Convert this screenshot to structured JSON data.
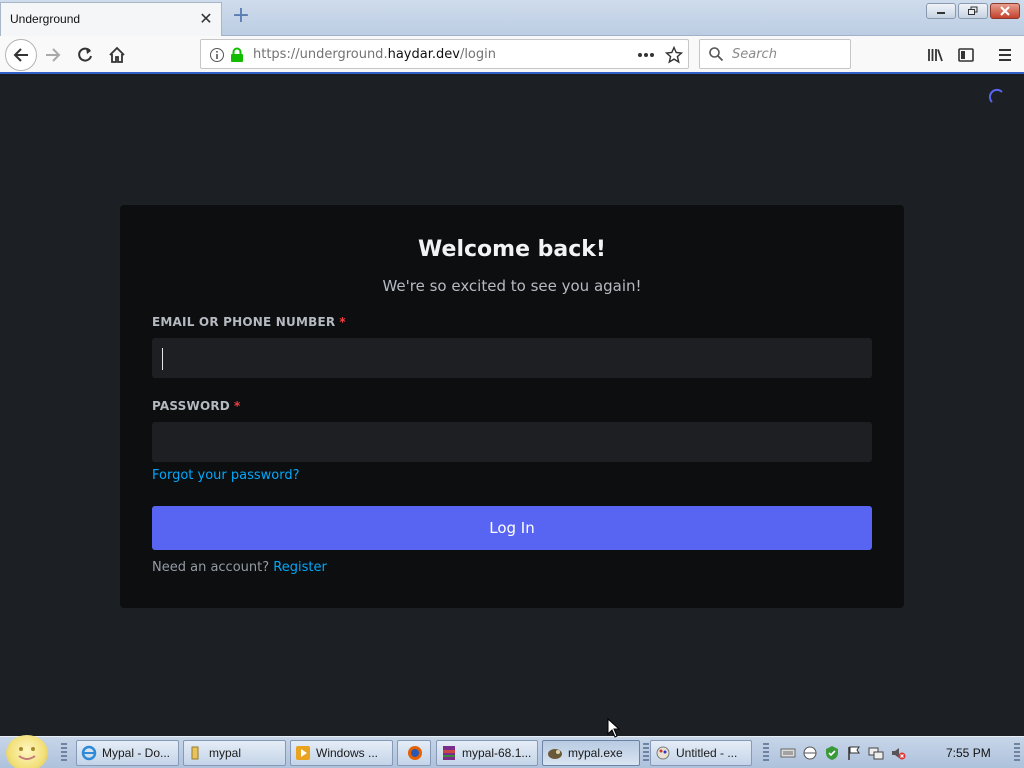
{
  "browser": {
    "tab_title": "Underground",
    "url_prefix": "https://underground.",
    "url_domain": "haydar.dev",
    "url_path": "/login",
    "search_placeholder": "Search"
  },
  "login": {
    "title": "Welcome back!",
    "subtitle": "We're so excited to see you again!",
    "email_label": "EMAIL OR PHONE NUMBER",
    "password_label": "PASSWORD",
    "required_mark": "*",
    "forgot_link": "Forgot your password?",
    "login_button": "Log In",
    "need_account": "Need an account?",
    "register_link": "Register"
  },
  "taskbar": {
    "items": [
      {
        "label": "Mypal - Do..."
      },
      {
        "label": "mypal"
      },
      {
        "label": "Windows ..."
      },
      {
        "label": "mypal-68.1..."
      },
      {
        "label": "mypal.exe"
      },
      {
        "label": "Untitled - ..."
      }
    ],
    "clock": "7:55 PM"
  },
  "colors": {
    "page_bg": "#1c2025",
    "card_bg": "#0d0e10",
    "accent": "#5865f2",
    "link": "#00a8fc",
    "required": "#f23f43"
  }
}
